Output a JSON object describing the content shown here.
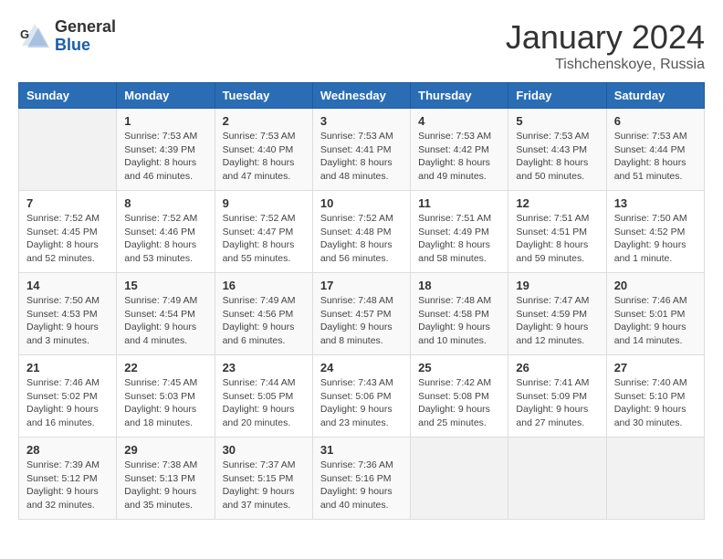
{
  "logo": {
    "general": "General",
    "blue": "Blue"
  },
  "title": "January 2024",
  "location": "Tishchenskoye, Russia",
  "days_of_week": [
    "Sunday",
    "Monday",
    "Tuesday",
    "Wednesday",
    "Thursday",
    "Friday",
    "Saturday"
  ],
  "weeks": [
    [
      {
        "day": "",
        "sunrise": "",
        "sunset": "",
        "daylight": ""
      },
      {
        "day": "1",
        "sunrise": "Sunrise: 7:53 AM",
        "sunset": "Sunset: 4:39 PM",
        "daylight": "Daylight: 8 hours and 46 minutes."
      },
      {
        "day": "2",
        "sunrise": "Sunrise: 7:53 AM",
        "sunset": "Sunset: 4:40 PM",
        "daylight": "Daylight: 8 hours and 47 minutes."
      },
      {
        "day": "3",
        "sunrise": "Sunrise: 7:53 AM",
        "sunset": "Sunset: 4:41 PM",
        "daylight": "Daylight: 8 hours and 48 minutes."
      },
      {
        "day": "4",
        "sunrise": "Sunrise: 7:53 AM",
        "sunset": "Sunset: 4:42 PM",
        "daylight": "Daylight: 8 hours and 49 minutes."
      },
      {
        "day": "5",
        "sunrise": "Sunrise: 7:53 AM",
        "sunset": "Sunset: 4:43 PM",
        "daylight": "Daylight: 8 hours and 50 minutes."
      },
      {
        "day": "6",
        "sunrise": "Sunrise: 7:53 AM",
        "sunset": "Sunset: 4:44 PM",
        "daylight": "Daylight: 8 hours and 51 minutes."
      }
    ],
    [
      {
        "day": "7",
        "sunrise": "Sunrise: 7:52 AM",
        "sunset": "Sunset: 4:45 PM",
        "daylight": "Daylight: 8 hours and 52 minutes."
      },
      {
        "day": "8",
        "sunrise": "Sunrise: 7:52 AM",
        "sunset": "Sunset: 4:46 PM",
        "daylight": "Daylight: 8 hours and 53 minutes."
      },
      {
        "day": "9",
        "sunrise": "Sunrise: 7:52 AM",
        "sunset": "Sunset: 4:47 PM",
        "daylight": "Daylight: 8 hours and 55 minutes."
      },
      {
        "day": "10",
        "sunrise": "Sunrise: 7:52 AM",
        "sunset": "Sunset: 4:48 PM",
        "daylight": "Daylight: 8 hours and 56 minutes."
      },
      {
        "day": "11",
        "sunrise": "Sunrise: 7:51 AM",
        "sunset": "Sunset: 4:49 PM",
        "daylight": "Daylight: 8 hours and 58 minutes."
      },
      {
        "day": "12",
        "sunrise": "Sunrise: 7:51 AM",
        "sunset": "Sunset: 4:51 PM",
        "daylight": "Daylight: 8 hours and 59 minutes."
      },
      {
        "day": "13",
        "sunrise": "Sunrise: 7:50 AM",
        "sunset": "Sunset: 4:52 PM",
        "daylight": "Daylight: 9 hours and 1 minute."
      }
    ],
    [
      {
        "day": "14",
        "sunrise": "Sunrise: 7:50 AM",
        "sunset": "Sunset: 4:53 PM",
        "daylight": "Daylight: 9 hours and 3 minutes."
      },
      {
        "day": "15",
        "sunrise": "Sunrise: 7:49 AM",
        "sunset": "Sunset: 4:54 PM",
        "daylight": "Daylight: 9 hours and 4 minutes."
      },
      {
        "day": "16",
        "sunrise": "Sunrise: 7:49 AM",
        "sunset": "Sunset: 4:56 PM",
        "daylight": "Daylight: 9 hours and 6 minutes."
      },
      {
        "day": "17",
        "sunrise": "Sunrise: 7:48 AM",
        "sunset": "Sunset: 4:57 PM",
        "daylight": "Daylight: 9 hours and 8 minutes."
      },
      {
        "day": "18",
        "sunrise": "Sunrise: 7:48 AM",
        "sunset": "Sunset: 4:58 PM",
        "daylight": "Daylight: 9 hours and 10 minutes."
      },
      {
        "day": "19",
        "sunrise": "Sunrise: 7:47 AM",
        "sunset": "Sunset: 4:59 PM",
        "daylight": "Daylight: 9 hours and 12 minutes."
      },
      {
        "day": "20",
        "sunrise": "Sunrise: 7:46 AM",
        "sunset": "Sunset: 5:01 PM",
        "daylight": "Daylight: 9 hours and 14 minutes."
      }
    ],
    [
      {
        "day": "21",
        "sunrise": "Sunrise: 7:46 AM",
        "sunset": "Sunset: 5:02 PM",
        "daylight": "Daylight: 9 hours and 16 minutes."
      },
      {
        "day": "22",
        "sunrise": "Sunrise: 7:45 AM",
        "sunset": "Sunset: 5:03 PM",
        "daylight": "Daylight: 9 hours and 18 minutes."
      },
      {
        "day": "23",
        "sunrise": "Sunrise: 7:44 AM",
        "sunset": "Sunset: 5:05 PM",
        "daylight": "Daylight: 9 hours and 20 minutes."
      },
      {
        "day": "24",
        "sunrise": "Sunrise: 7:43 AM",
        "sunset": "Sunset: 5:06 PM",
        "daylight": "Daylight: 9 hours and 23 minutes."
      },
      {
        "day": "25",
        "sunrise": "Sunrise: 7:42 AM",
        "sunset": "Sunset: 5:08 PM",
        "daylight": "Daylight: 9 hours and 25 minutes."
      },
      {
        "day": "26",
        "sunrise": "Sunrise: 7:41 AM",
        "sunset": "Sunset: 5:09 PM",
        "daylight": "Daylight: 9 hours and 27 minutes."
      },
      {
        "day": "27",
        "sunrise": "Sunrise: 7:40 AM",
        "sunset": "Sunset: 5:10 PM",
        "daylight": "Daylight: 9 hours and 30 minutes."
      }
    ],
    [
      {
        "day": "28",
        "sunrise": "Sunrise: 7:39 AM",
        "sunset": "Sunset: 5:12 PM",
        "daylight": "Daylight: 9 hours and 32 minutes."
      },
      {
        "day": "29",
        "sunrise": "Sunrise: 7:38 AM",
        "sunset": "Sunset: 5:13 PM",
        "daylight": "Daylight: 9 hours and 35 minutes."
      },
      {
        "day": "30",
        "sunrise": "Sunrise: 7:37 AM",
        "sunset": "Sunset: 5:15 PM",
        "daylight": "Daylight: 9 hours and 37 minutes."
      },
      {
        "day": "31",
        "sunrise": "Sunrise: 7:36 AM",
        "sunset": "Sunset: 5:16 PM",
        "daylight": "Daylight: 9 hours and 40 minutes."
      },
      {
        "day": "",
        "sunrise": "",
        "sunset": "",
        "daylight": ""
      },
      {
        "day": "",
        "sunrise": "",
        "sunset": "",
        "daylight": ""
      },
      {
        "day": "",
        "sunrise": "",
        "sunset": "",
        "daylight": ""
      }
    ]
  ]
}
